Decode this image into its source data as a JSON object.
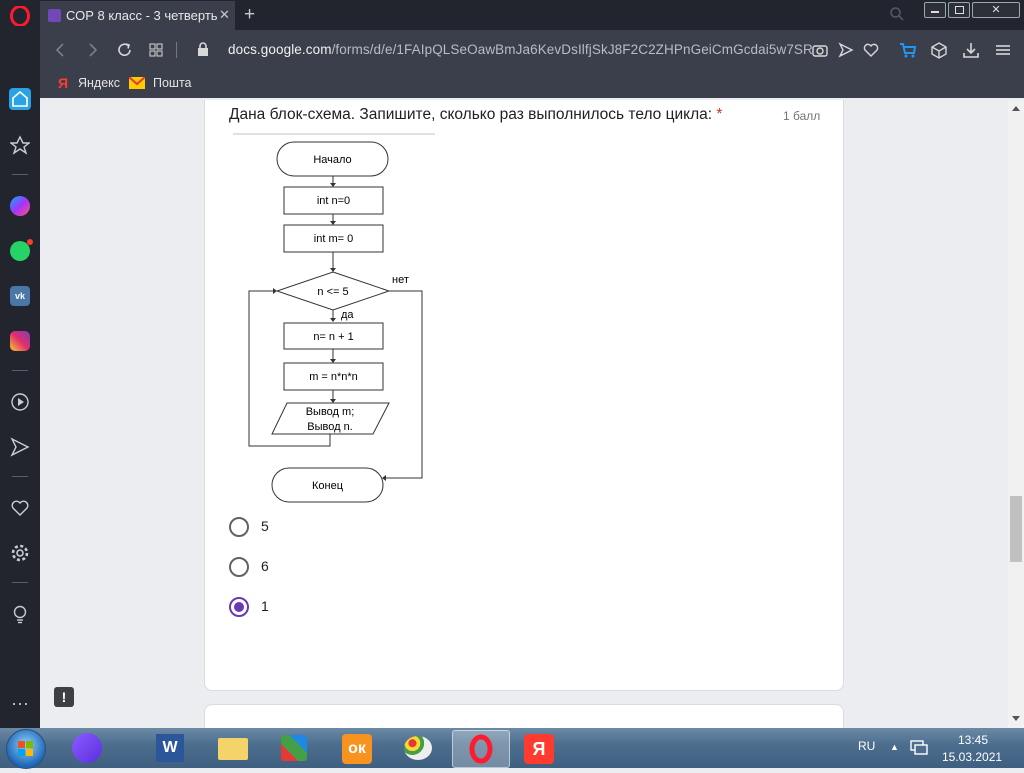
{
  "browser": {
    "tab_title": "СОР 8 класс - 3 четверть",
    "url_host": "docs.google.com",
    "url_path": "/forms/d/e/1FAIpQLSeOawBmJa6KevDsIlfjSkJ8F2C2ZHPnGeiCmGcdai5w7SR",
    "bookmarks": [
      "Яндекс",
      "Пошта"
    ]
  },
  "question": {
    "text": "Дана блок-схема. Запишите, сколько раз выполнилось тело цикла:",
    "required_mark": "*",
    "points": "1 балл"
  },
  "flowchart": {
    "start": "Начало",
    "step1": "int n=0",
    "step2": "int m= 0",
    "condition": "n <= 5",
    "no_label": "нет",
    "yes_label": "да",
    "step3": "n= n + 1",
    "step4": "m = n*n*n",
    "output_line1": "Вывод m;",
    "output_line2": "Вывод n.",
    "end": "Конец"
  },
  "options": [
    {
      "label": "5",
      "selected": false
    },
    {
      "label": "6",
      "selected": false
    },
    {
      "label": "1",
      "selected": true
    }
  ],
  "tray": {
    "lang": "RU",
    "time": "13:45",
    "date": "15.03.2021"
  },
  "colors": {
    "accent": "#673ab7",
    "required": "#d93025"
  }
}
